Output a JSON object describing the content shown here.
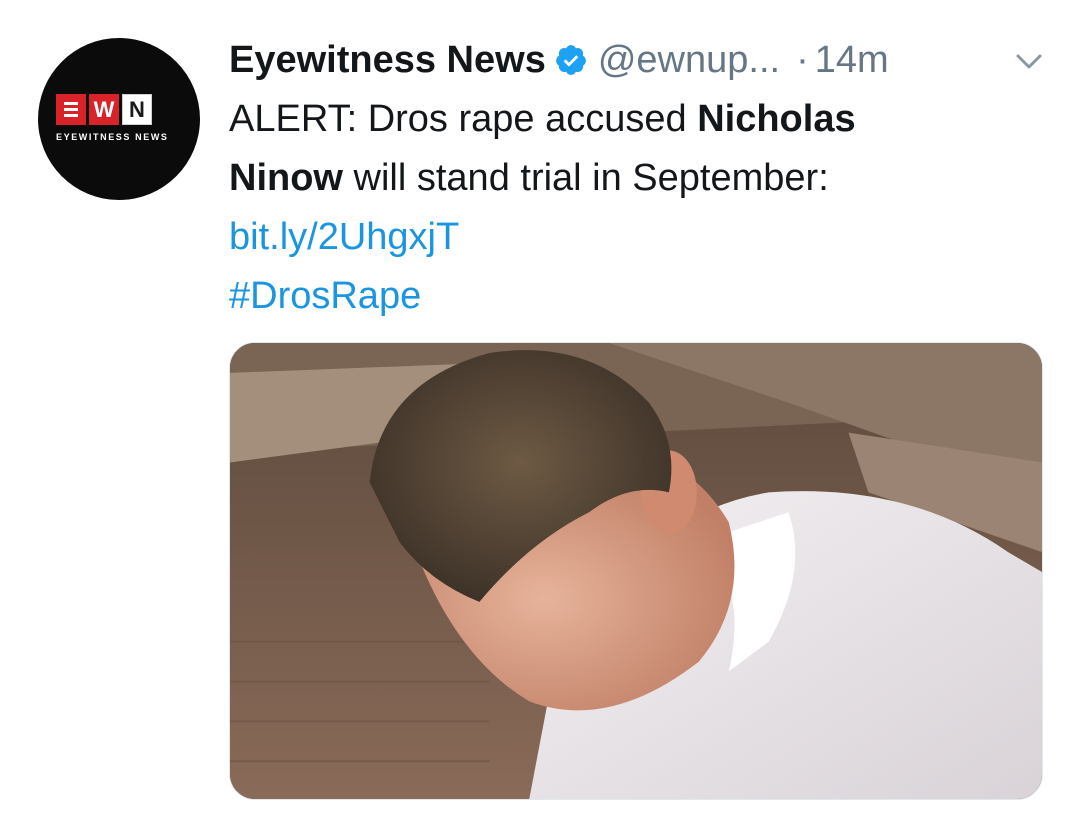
{
  "author": {
    "display_name": "Eyewitness News",
    "handle": "@ewnup...",
    "separator": "·",
    "timestamp": "14m",
    "verified": true,
    "avatar_logo": {
      "letter_w": "W",
      "letter_n": "N",
      "tagline": "EYEWITNESS NEWS"
    }
  },
  "tweet": {
    "text_line1_prefix": "ALERT: Dros rape accused ",
    "text_bold_1": "Nicholas",
    "text_bold_2": "Ninow",
    "text_line2_suffix": " will stand trial in September:",
    "link": "bit.ly/2UhgxjT",
    "hashtag": "#DrosRape"
  },
  "media": {
    "icon": "photo-image"
  },
  "colors": {
    "link": "#1b95e0",
    "muted": "#657786",
    "verified": "#1da1f2",
    "ewn_red": "#d9232a"
  }
}
